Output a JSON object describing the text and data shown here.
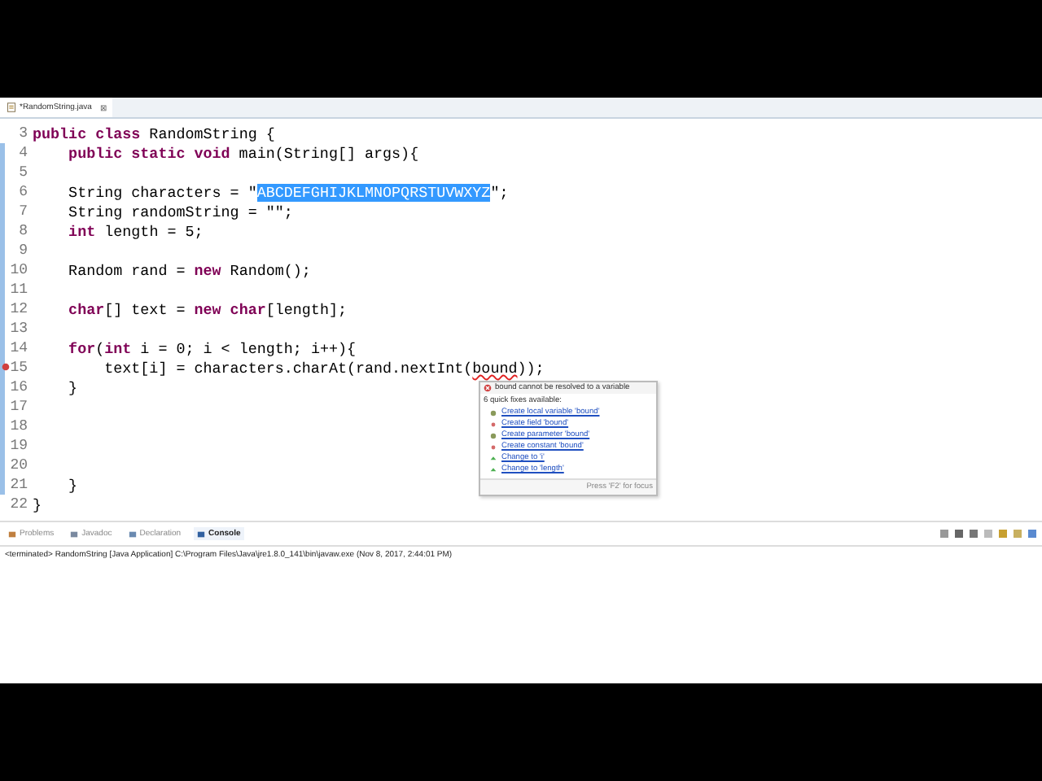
{
  "editor_tab": {
    "title": "*RandomString.java",
    "close": "⊠"
  },
  "code_lines": [
    {
      "number": "3",
      "changed": false,
      "tokens": [
        {
          "kind": "keyword",
          "text": "public class"
        },
        {
          "kind": "plain",
          "text": " RandomString {"
        }
      ]
    },
    {
      "number": "4",
      "changed": true,
      "tokens": [
        {
          "kind": "keyword",
          "text": "    public static void"
        },
        {
          "kind": "plain",
          "text": " main(String[] args){"
        }
      ]
    },
    {
      "number": "5",
      "changed": true
    },
    {
      "number": "6",
      "changed": true,
      "tokens": [
        {
          "kind": "plain",
          "text": "    String characters = \""
        },
        {
          "kind": "selected",
          "text": "ABCDEFGHIJKLMNOPQRSTUVWXYZ"
        },
        {
          "kind": "plain",
          "text": "\";"
        }
      ]
    },
    {
      "number": "7",
      "changed": true,
      "tokens": [
        {
          "kind": "plain",
          "text": "    String randomString = \"\";"
        }
      ]
    },
    {
      "number": "8",
      "changed": true,
      "tokens": [
        {
          "kind": "keyword",
          "text": "    int"
        },
        {
          "kind": "plain",
          "text": " length = 5;"
        }
      ]
    },
    {
      "number": "9",
      "changed": true
    },
    {
      "number": "10",
      "changed": true,
      "tokens": [
        {
          "kind": "plain",
          "text": "    Random rand = "
        },
        {
          "kind": "keyword",
          "text": "new"
        },
        {
          "kind": "plain",
          "text": " Random();"
        }
      ]
    },
    {
      "number": "11",
      "changed": true
    },
    {
      "number": "12",
      "changed": true,
      "tokens": [
        {
          "kind": "keyword",
          "text": "    char"
        },
        {
          "kind": "plain",
          "text": "[] text = "
        },
        {
          "kind": "keyword",
          "text": "new char"
        },
        {
          "kind": "plain",
          "text": "[length];"
        }
      ]
    },
    {
      "number": "13",
      "changed": true
    },
    {
      "number": "14",
      "changed": true,
      "tokens": [
        {
          "kind": "keyword",
          "text": "    for"
        },
        {
          "kind": "plain",
          "text": "("
        },
        {
          "kind": "keyword",
          "text": "int"
        },
        {
          "kind": "plain",
          "text": " i = 0; i < length; i++){"
        }
      ]
    },
    {
      "number": "15",
      "changed": true,
      "error": true,
      "tokens": [
        {
          "kind": "plain",
          "text": "        text[i] = characters.charAt(rand.nextInt("
        },
        {
          "kind": "error",
          "text": "bound"
        },
        {
          "kind": "plain",
          "text": "));"
        }
      ]
    },
    {
      "number": "16",
      "changed": true,
      "tokens": [
        {
          "kind": "plain",
          "text": "    }"
        }
      ]
    },
    {
      "number": "17",
      "changed": true
    },
    {
      "number": "18",
      "changed": true
    },
    {
      "number": "19",
      "changed": true
    },
    {
      "number": "20",
      "changed": true
    },
    {
      "number": "21",
      "changed": true,
      "tokens": [
        {
          "kind": "plain",
          "text": "    }"
        }
      ]
    },
    {
      "number": "22",
      "changed": false,
      "tokens": [
        {
          "kind": "plain",
          "text": "}"
        }
      ]
    }
  ],
  "quick_fix": {
    "problem": "bound cannot be resolved to a variable",
    "summary": "6 quick fixes available:",
    "fixes": [
      {
        "kind": "local",
        "label": "Create local variable 'bound'"
      },
      {
        "kind": "field",
        "label": "Create field 'bound'"
      },
      {
        "kind": "parameter",
        "label": "Create parameter 'bound'"
      },
      {
        "kind": "constant",
        "label": "Create constant 'bound'"
      },
      {
        "kind": "change",
        "label": "Change to 'i'"
      },
      {
        "kind": "change",
        "label": "Change to 'length'"
      }
    ],
    "footer": "Press 'F2' for focus"
  },
  "view_tabs": [
    {
      "kind": "problems",
      "label": "Problems",
      "selected": false
    },
    {
      "kind": "javadoc",
      "label": "Javadoc",
      "selected": false
    },
    {
      "kind": "declaration",
      "label": "Declaration",
      "selected": false
    },
    {
      "kind": "console",
      "label": "Console",
      "selected": true
    }
  ],
  "console_header": "<terminated> RandomString [Java Application] C:\\Program Files\\Java\\jre1.8.0_141\\bin\\javaw.exe (Nov 8, 2017, 2:44:01 PM)"
}
